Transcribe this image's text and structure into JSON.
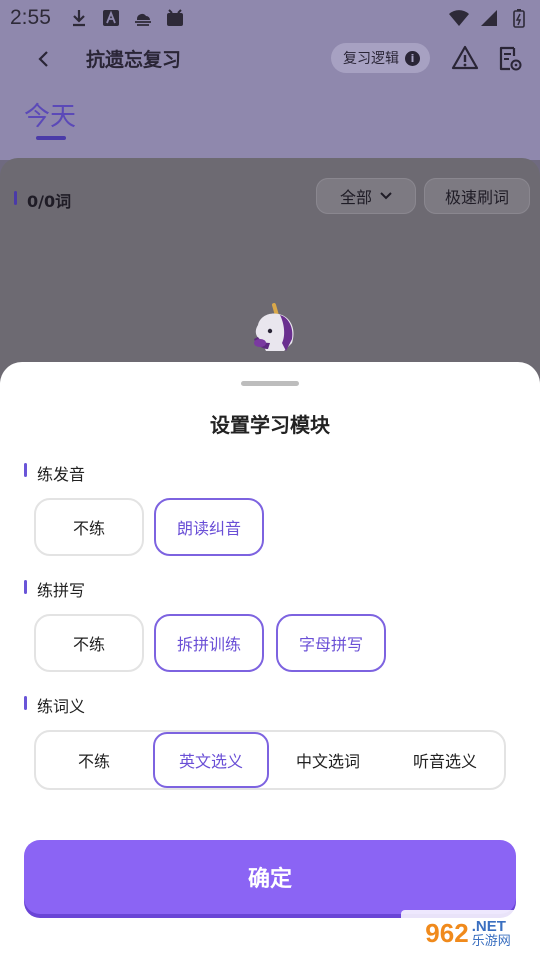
{
  "status": {
    "time": "2:55"
  },
  "header": {
    "title": "抗遗忘复习",
    "logic_label": "复习逻辑",
    "info_glyph": "i"
  },
  "date_tab": "今天",
  "card": {
    "word_count": "0/0词",
    "filter_label": "全部",
    "fast_label": "极速刷词"
  },
  "sheet": {
    "title": "设置学习模块",
    "sections": [
      {
        "label": "练发音",
        "options": [
          "不练",
          "朗读纠音"
        ],
        "selected": 1
      },
      {
        "label": "练拼写",
        "options": [
          "不练",
          "拆拼训练",
          "字母拼写"
        ],
        "selected": [
          1,
          2
        ]
      },
      {
        "label": "练词义",
        "options": [
          "不练",
          "英文选义",
          "中文选词",
          "听音选义"
        ],
        "selected": 1
      }
    ],
    "confirm_label": "确定"
  },
  "watermark": {
    "number": "962",
    "suffix": ".NET",
    "site": "乐游网"
  },
  "colors": {
    "accent": "#8b64f4",
    "selected_border": "#7d63e0"
  }
}
